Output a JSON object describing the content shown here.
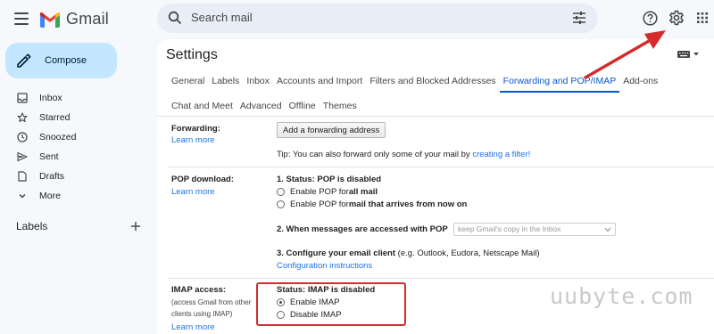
{
  "app": {
    "name": "Gmail"
  },
  "search": {
    "placeholder": "Search mail"
  },
  "compose": {
    "label": "Compose"
  },
  "sidebar": {
    "items": [
      {
        "label": "Inbox",
        "icon": "inbox-icon"
      },
      {
        "label": "Starred",
        "icon": "star-icon"
      },
      {
        "label": "Snoozed",
        "icon": "clock-icon"
      },
      {
        "label": "Sent",
        "icon": "send-icon"
      },
      {
        "label": "Drafts",
        "icon": "draft-icon"
      },
      {
        "label": "More",
        "icon": "chevron-down-icon"
      }
    ],
    "labels_heading": "Labels"
  },
  "settings": {
    "title": "Settings",
    "tabs_row1": [
      "General",
      "Labels",
      "Inbox",
      "Accounts and Import",
      "Filters and Blocked Addresses",
      "Forwarding and POP/IMAP",
      "Add-ons"
    ],
    "tabs_row2": [
      "Chat and Meet",
      "Advanced",
      "Offline",
      "Themes"
    ],
    "active_tab": "Forwarding and POP/IMAP",
    "forwarding": {
      "label": "Forwarding:",
      "learn_more": "Learn more",
      "button": "Add a forwarding address",
      "tip_prefix": "Tip: You can also forward only some of your mail by ",
      "tip_link": "creating a filter!"
    },
    "pop": {
      "label": "POP download:",
      "learn_more": "Learn more",
      "status": "1. Status: POP is disabled",
      "opt1_prefix": "Enable POP for ",
      "opt1_bold": "all mail",
      "opt2_prefix": "Enable POP for ",
      "opt2_bold": "mail that arrives from now on",
      "when_heading": "2. When messages are accessed with POP",
      "when_select": "keep Gmail's copy in the Inbox",
      "configure_heading": "3. Configure your email client",
      "configure_note": " (e.g. Outlook, Eudora, Netscape Mail)",
      "configure_link": "Configuration instructions"
    },
    "imap": {
      "label": "IMAP access:",
      "note_line1": "(access Gmail from other",
      "note_line2": "clients using IMAP)",
      "learn_more": "Learn more",
      "status": "Status: IMAP is disabled",
      "enable": "Enable IMAP",
      "disable": "Disable IMAP",
      "selected": "enable"
    }
  },
  "watermark": "uubyte.com",
  "colors": {
    "accent": "#0b57d0",
    "compose_bg": "#c2e7ff",
    "annotation_red": "#d32c2c"
  }
}
